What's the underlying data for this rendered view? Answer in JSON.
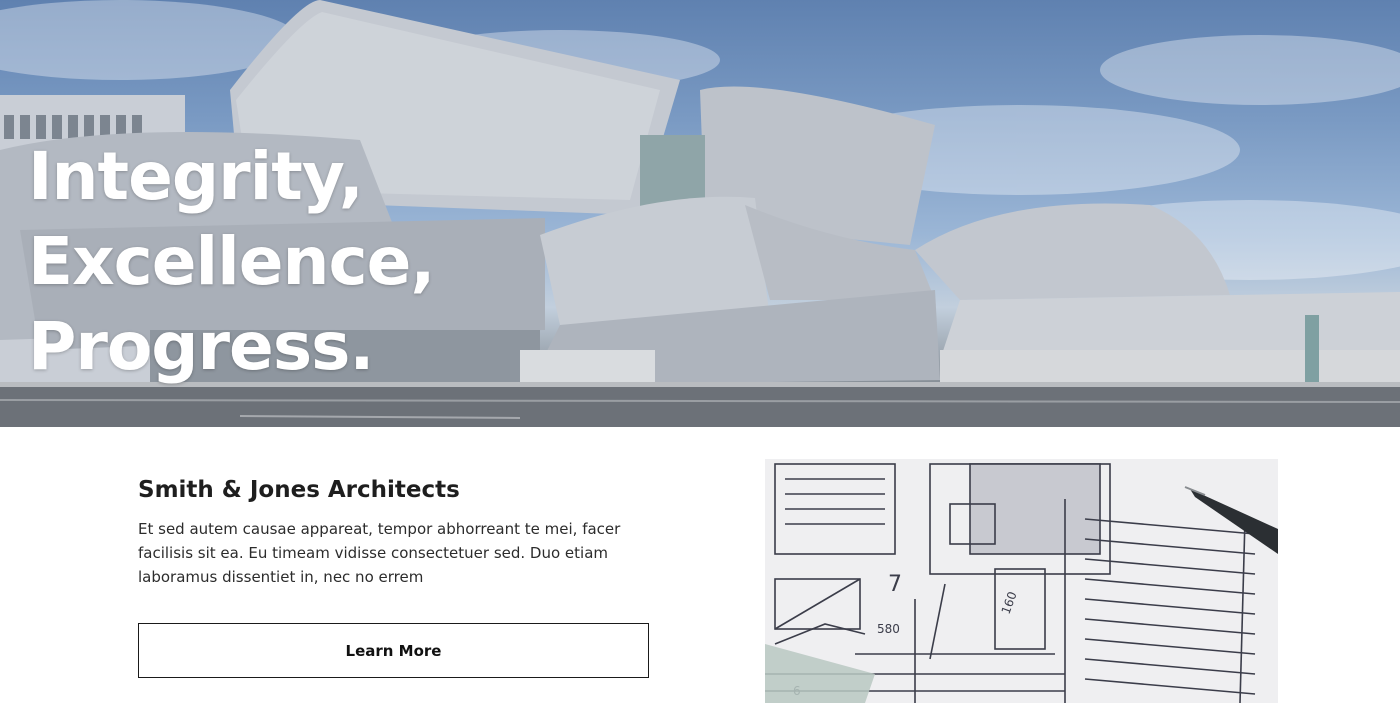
{
  "hero": {
    "headline_lines": [
      "Integrity,",
      "Excellence,",
      "Progress."
    ],
    "image": "concert-hall-photo"
  },
  "intro": {
    "title": "Smith & Jones Architects",
    "description": "Et sed autem causae appareat, tempor abhorreant te mei, facer facilisis sit ea. Eu timeam vidisse consectetuer sed. Duo etiam laboramus dissentiet in, nec no errem",
    "button_label": "Learn More"
  },
  "blueprint": {
    "image": "blueprint-with-pen-photo",
    "labels": [
      "7",
      "580",
      "160",
      "6"
    ]
  },
  "colors": {
    "sky": "#6f90bd",
    "steel": "#b7bcc4",
    "text": "#1e1e1e",
    "button_border": "#1a1a1a",
    "headline": "#ffffff"
  }
}
